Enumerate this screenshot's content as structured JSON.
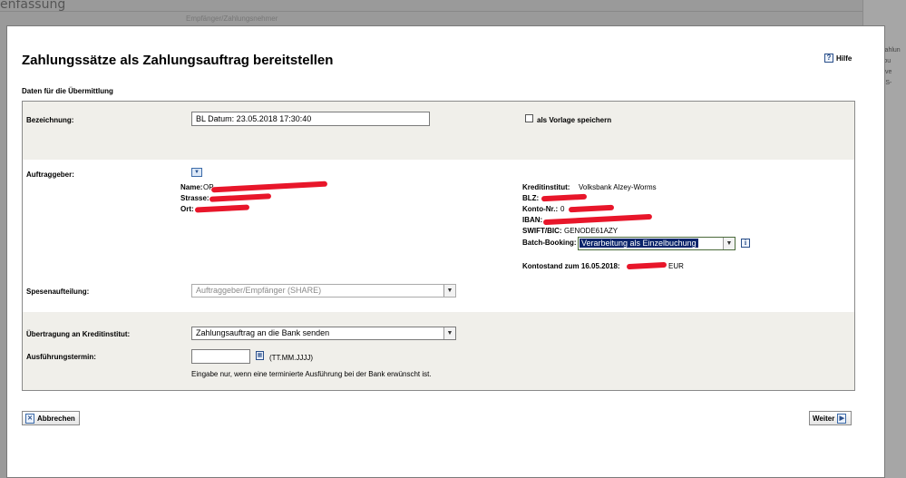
{
  "background": {
    "title": "enfassung",
    "subtitle": "Empfänger/Zahlungsnehmer",
    "right_items": [
      "BB Zahlun",
      "Kontou",
      "Bankve",
      "EBICS-"
    ]
  },
  "dialog": {
    "title": "Zahlungssätze als Zahlungsauftrag bereitstellen",
    "help_label": "Hilfe",
    "section_title": "Daten für die Übermittlung"
  },
  "form": {
    "bezeichnung_label": "Bezeichnung:",
    "bezeichnung_value": "BL Datum: 23.05.2018 17:30:40",
    "vorlage_label": "als Vorlage speichern",
    "auftraggeber_label": "Auftraggeber:",
    "name_label": "Name:",
    "name_value": "OP",
    "strasse_label": "Strasse:",
    "ort_label": "Ort:",
    "kreditinstitut_label": "Kreditinstitut:",
    "kreditinstitut_value": "Volksbank Alzey-Worms",
    "blz_label": "BLZ:",
    "konto_label": "Konto-Nr.:",
    "konto_value": "0",
    "iban_label": "IBAN:",
    "swift_label": "SWIFT/BIC:",
    "swift_value": "GENODE61AZY",
    "batch_label": "Batch-Booking:",
    "batch_value": "Verarbeitung als Einzelbuchung",
    "kontostand_label": "Kontostand zum 16.05.2018:",
    "kontostand_currency": "EUR",
    "spesen_label": "Spesenaufteilung:",
    "spesen_value": "Auftraggeber/Empfänger (SHARE)",
    "uebertragung_label": "Übertragung an Kreditinstitut:",
    "uebertragung_value": "Zahlungsauftrag an die Bank senden",
    "termin_label": "Ausführungstermin:",
    "termin_value": "",
    "termin_format": "(TT.MM.JJJJ)",
    "termin_hint": "Eingabe nur, wenn eine terminierte Ausführung bei der Bank erwünscht ist."
  },
  "buttons": {
    "cancel": "Abbrechen",
    "next": "Weiter"
  },
  "colors": {
    "redaction": "#e8162a",
    "selection": "#0a246a",
    "band": "#f0efea"
  }
}
